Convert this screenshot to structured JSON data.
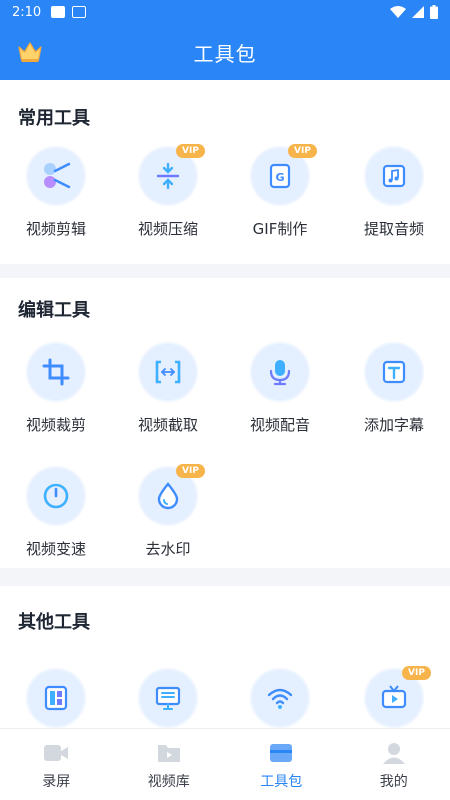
{
  "status": {
    "time": "2:10"
  },
  "header": {
    "title": "工具包",
    "crown_icon": "crown-icon"
  },
  "sections": [
    {
      "title": "常用工具",
      "tools": [
        {
          "label": "视频剪辑",
          "icon": "scissors-icon",
          "vip": false
        },
        {
          "label": "视频压缩",
          "icon": "compress-icon",
          "vip": true
        },
        {
          "label": "GIF制作",
          "icon": "gif-icon",
          "vip": true
        },
        {
          "label": "提取音频",
          "icon": "music-note-icon",
          "vip": false
        }
      ]
    },
    {
      "title": "编辑工具",
      "tools": [
        {
          "label": "视频裁剪",
          "icon": "crop-icon",
          "vip": false
        },
        {
          "label": "视频截取",
          "icon": "trim-icon",
          "vip": false
        },
        {
          "label": "视频配音",
          "icon": "microphone-icon",
          "vip": false
        },
        {
          "label": "添加字幕",
          "icon": "text-icon",
          "vip": false
        },
        {
          "label": "视频变速",
          "icon": "speed-gauge-icon",
          "vip": false
        },
        {
          "label": "去水印",
          "icon": "water-drop-icon",
          "vip": true
        }
      ]
    },
    {
      "title": "其他工具",
      "tools": [
        {
          "label": "",
          "icon": "layout-icon",
          "vip": false
        },
        {
          "label": "",
          "icon": "monitor-list-icon",
          "vip": false
        },
        {
          "label": "",
          "icon": "wifi-icon",
          "vip": false
        },
        {
          "label": "",
          "icon": "tv-play-icon",
          "vip": true
        }
      ]
    }
  ],
  "vip_label": "VIP",
  "tabbar": [
    {
      "label": "录屏",
      "icon": "camera-icon",
      "active": false
    },
    {
      "label": "视频库",
      "icon": "folder-video-icon",
      "active": false
    },
    {
      "label": "工具包",
      "icon": "toolbox-icon",
      "active": true
    },
    {
      "label": "我的",
      "icon": "user-icon",
      "active": false
    }
  ],
  "colors": {
    "primary": "#2a86f6",
    "vip": "#f7b44a",
    "icon_bg": "#e4efff"
  }
}
